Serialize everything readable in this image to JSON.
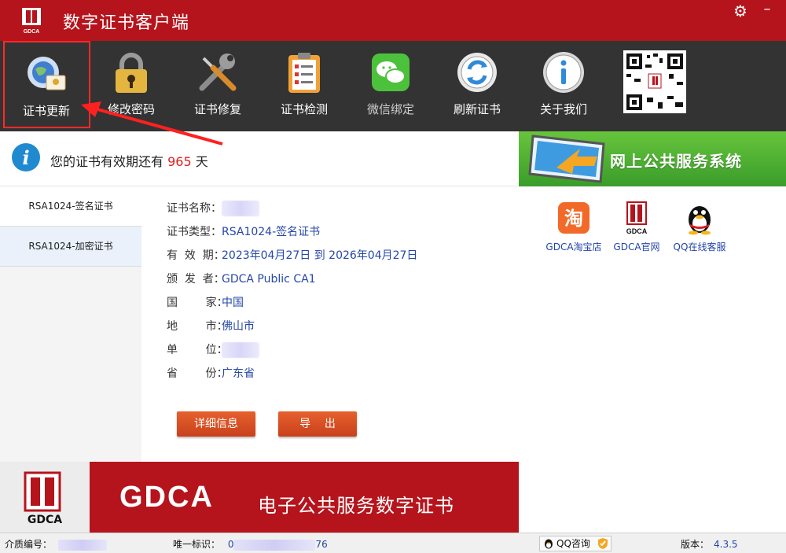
{
  "window": {
    "title": "数字证书客户端",
    "logo_text": "GDCA"
  },
  "toolbar": {
    "items": [
      {
        "label": "证书更新",
        "icon": "certificate-globe-icon",
        "selected": true
      },
      {
        "label": "修改密码",
        "icon": "padlock-icon"
      },
      {
        "label": "证书修复",
        "icon": "wrench-screwdriver-icon"
      },
      {
        "label": "证书检测",
        "icon": "checklist-clipboard-icon"
      },
      {
        "label": "微信绑定",
        "icon": "wechat-icon"
      },
      {
        "label": "刷新证书",
        "icon": "refresh-icon"
      },
      {
        "label": "关于我们",
        "icon": "info-icon"
      }
    ],
    "qr_icon": "qr-code-icon"
  },
  "info": {
    "prefix": "您的证书有效期还有 ",
    "days": "965",
    "suffix": " 天"
  },
  "banner": {
    "text": "网上公共服务系统"
  },
  "cert_list": [
    {
      "label": "RSA1024-签名证书"
    },
    {
      "label": "RSA1024-加密证书"
    }
  ],
  "details": {
    "name_label": "证书名称：",
    "type_label": "证书类型：",
    "type_value": "RSA1024-签名证书",
    "validity_label": "有  效  期：",
    "validity_value": "2023年04月27日 到 2026年04月27日",
    "issuer_label": "颁  发  者：",
    "issuer_value": "GDCA Public CA1",
    "country_label": "国        家：",
    "country_value": "中国",
    "city_label": "地        市：",
    "city_value": "佛山市",
    "unit_label": "单        位：",
    "province_label": "省        份：",
    "province_value": "广东省"
  },
  "buttons": {
    "details": "详细信息",
    "export": "导    出"
  },
  "links": [
    {
      "label": "GDCA淘宝店",
      "icon": "taobao-icon"
    },
    {
      "label": "GDCA官网",
      "icon": "gdca-logo-icon"
    },
    {
      "label": "QQ在线客服",
      "icon": "qq-penguin-icon"
    }
  ],
  "bottom_banner": {
    "logo_text": "GDCA",
    "brand": "GDCA",
    "slogan": "电子公共服务数字证书"
  },
  "status": {
    "media_label": "介质编号：",
    "uid_label": "唯一标识：",
    "uid_start": "0",
    "uid_end": "76",
    "qq_label": "QQ咨询",
    "version_label": "版本：",
    "version_value": "4.3.5"
  },
  "colors": {
    "title_red": "#b5141c",
    "toolbar_dark": "#333333",
    "link_blue": "#2547a7",
    "days_red": "#e02020",
    "button_orange": "#d44f22",
    "banner_green": "#4fb232"
  }
}
